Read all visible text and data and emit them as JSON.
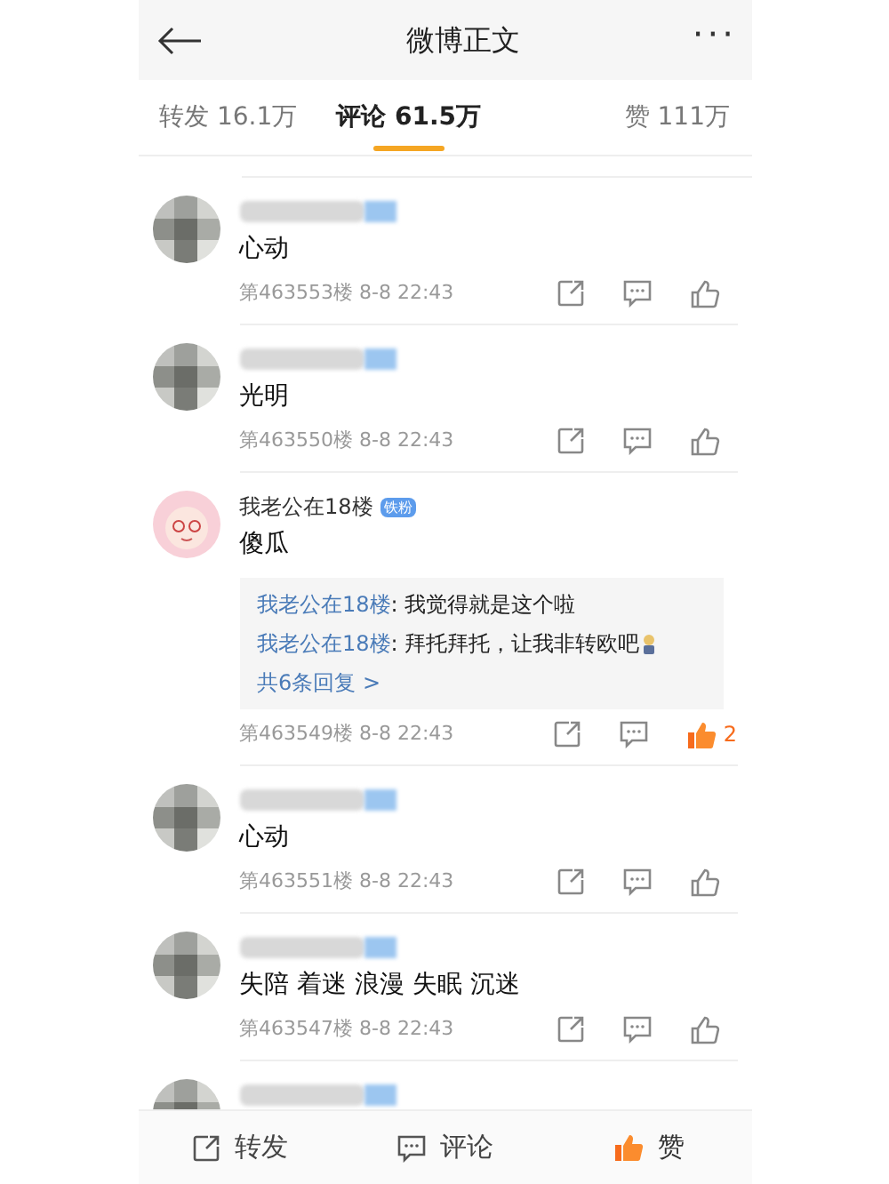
{
  "header": {
    "title": "微博正文",
    "more": "···"
  },
  "tabs": [
    {
      "label": "转发 16.1万",
      "selected": false
    },
    {
      "label": "评论 61.5万",
      "selected": true
    },
    {
      "label": "赞 111万",
      "selected": false
    }
  ],
  "comments": [
    {
      "kind": "obscured",
      "text": "心动",
      "meta": "第463553楼 8-8 22:43",
      "liked": false
    },
    {
      "kind": "obscured",
      "text": "光明",
      "meta": "第463550楼 8-8 22:43",
      "liked": false
    },
    {
      "kind": "named",
      "name": "我老公在18楼",
      "badge": "铁粉",
      "text": "傻瓜",
      "replies": [
        {
          "author": "我老公在18楼",
          "text": ": 我觉得就是这个啦"
        },
        {
          "author": "我老公在18楼",
          "text": ": 拜托拜托，让我非转欧吧",
          "emoji": true
        }
      ],
      "more_replies": "共6条回复 >",
      "meta": "第463549楼 8-8 22:43",
      "liked": true,
      "like_count": "2"
    },
    {
      "kind": "obscured",
      "text": "心动",
      "meta": "第463551楼 8-8 22:43",
      "liked": false
    },
    {
      "kind": "obscured",
      "text": "失陪 着迷 浪漫 失眠 沉迷",
      "meta": "第463547楼 8-8 22:43",
      "liked": false
    },
    {
      "kind": "obscured"
    }
  ],
  "bottom_bar": [
    {
      "kind": "share",
      "label": "转发",
      "active": false
    },
    {
      "kind": "comment",
      "label": "评论",
      "active": false
    },
    {
      "kind": "like",
      "label": "赞",
      "active": true
    }
  ]
}
